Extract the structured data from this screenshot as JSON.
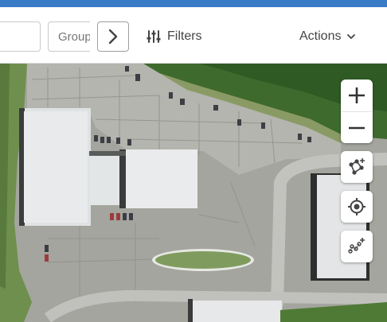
{
  "toolbar": {
    "group_placeholder": "Group",
    "next_icon": "chevron-right-icon",
    "filters_label": "Filters",
    "filters_icon": "sliders-icon",
    "actions_label": "Actions",
    "actions_icon": "chevron-down-icon"
  },
  "map": {
    "type": "satellite",
    "controls": [
      {
        "name": "zoom-in",
        "icon": "plus-icon"
      },
      {
        "name": "zoom-out",
        "icon": "minus-icon"
      },
      {
        "name": "draw-polygon",
        "icon": "polygon-add-icon"
      },
      {
        "name": "my-location",
        "icon": "crosshair-icon"
      },
      {
        "name": "draw-route",
        "icon": "route-add-icon"
      }
    ]
  },
  "colors": {
    "top_bar": "#3a7bc8",
    "control_icon": "#444444"
  }
}
